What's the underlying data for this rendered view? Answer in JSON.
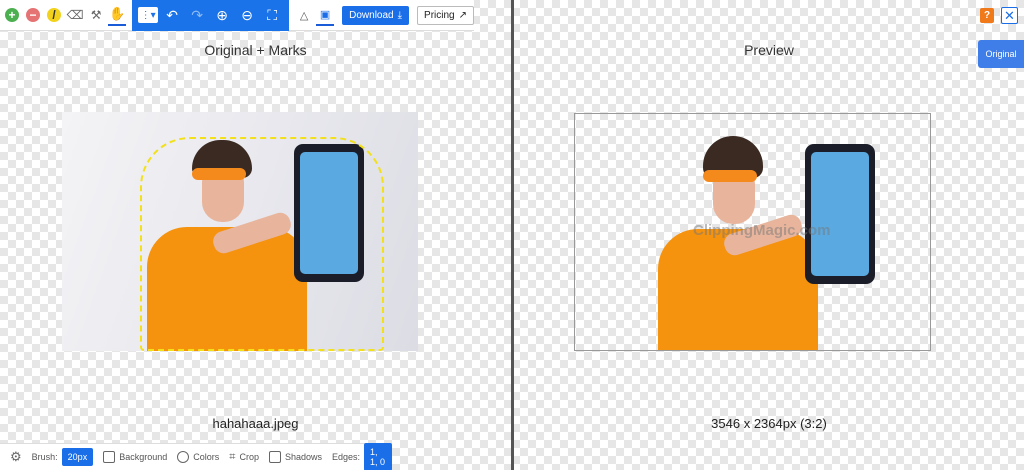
{
  "toolbar": {
    "tools": [
      {
        "name": "add-icon",
        "glyph": "+",
        "color": "#4caf50"
      },
      {
        "name": "remove-icon",
        "glyph": "−",
        "color": "#e57373"
      },
      {
        "name": "pen-icon",
        "glyph": "/",
        "color": "#f2d21c"
      },
      {
        "name": "eraser-icon",
        "glyph": "⌫"
      },
      {
        "name": "wand-icon",
        "glyph": "⚒"
      },
      {
        "name": "hand-icon",
        "glyph": "✋"
      }
    ],
    "download_label": "Download",
    "pricing_label": "Pricing"
  },
  "left": {
    "title": "Original + Marks",
    "caption": "hahahaaa.jpeg"
  },
  "right": {
    "title": "Preview",
    "caption": "3546 x 2364px (3:2)",
    "watermark": "ClippingMagic.com",
    "help_label": "?",
    "close_label": "✕",
    "original_tab": "Original"
  },
  "bottom": {
    "brush_label": "Brush:",
    "brush_value": "20px",
    "background_label": "Background",
    "colors_label": "Colors",
    "crop_label": "Crop",
    "shadows_label": "Shadows",
    "edges_label": "Edges:",
    "edges_value": "1, 1, 0"
  },
  "colors": {
    "accent": "#1a6ee8",
    "jacket": "#f5920e",
    "help": "#f07a1a"
  }
}
